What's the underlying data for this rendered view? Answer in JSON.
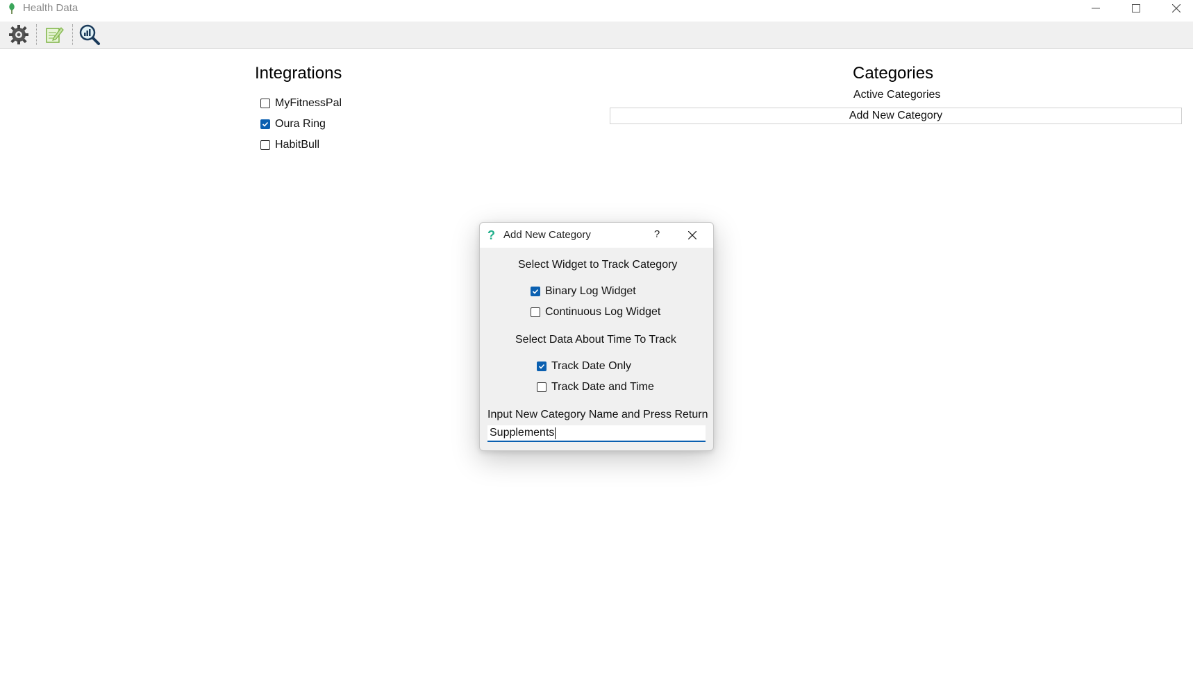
{
  "window": {
    "title": "Health Data",
    "controls": [
      "minimize",
      "maximize",
      "close"
    ]
  },
  "toolbar": {
    "items": [
      {
        "icon": "settings-gear-icon"
      },
      {
        "icon": "edit-note-icon"
      },
      {
        "icon": "search-chart-icon"
      }
    ]
  },
  "integrations": {
    "title": "Integrations",
    "items": [
      {
        "label": "MyFitnessPal",
        "checked": false
      },
      {
        "label": "Oura Ring",
        "checked": true
      },
      {
        "label": "HabitBull",
        "checked": false
      }
    ]
  },
  "categories": {
    "title": "Categories",
    "subtitle": "Active Categories",
    "add_button": "Add New Category"
  },
  "dialog": {
    "title": "Add New Category",
    "help_label": "?",
    "widget_prompt": "Select Widget to Track Category",
    "widget_options": [
      {
        "label": "Binary Log Widget",
        "checked": true
      },
      {
        "label": "Continuous Log Widget",
        "checked": false
      }
    ],
    "time_prompt": "Select Data About Time To Track",
    "time_options": [
      {
        "label": "Track Date Only",
        "checked": true
      },
      {
        "label": "Track Date and Time",
        "checked": false
      }
    ],
    "name_prompt": "Input New Category Name and Press Return",
    "name_value": "Supplements"
  },
  "colors": {
    "accent": "#0a5fb0",
    "toolbar_bg": "#f0f0f0",
    "dialog_bg": "#f0f0f0",
    "help_icon": "#1fae8a"
  }
}
